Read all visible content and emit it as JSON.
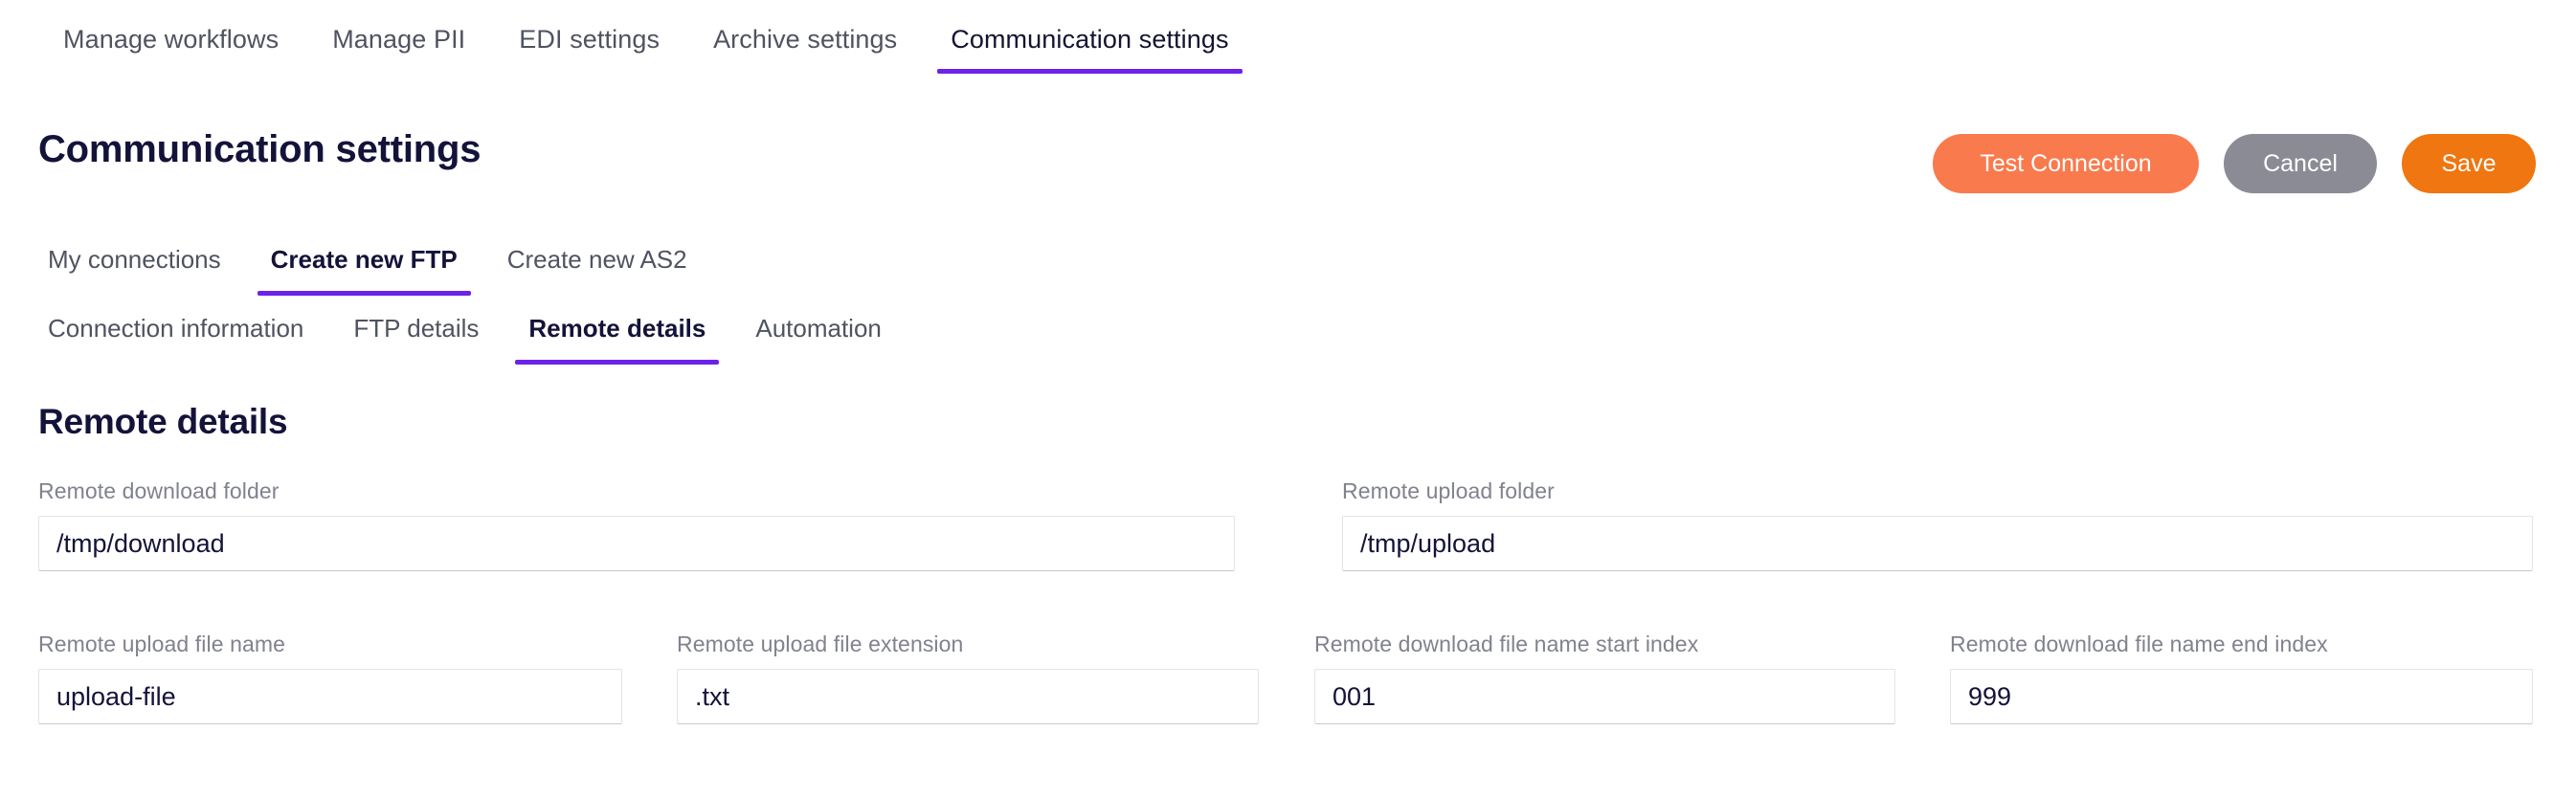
{
  "topnav": {
    "items": [
      {
        "label": "Manage workflows",
        "active": false
      },
      {
        "label": "Manage PII",
        "active": false
      },
      {
        "label": "EDI settings",
        "active": false
      },
      {
        "label": "Archive settings",
        "active": false
      },
      {
        "label": "Communication settings",
        "active": true
      }
    ]
  },
  "header": {
    "title": "Communication settings",
    "actions": {
      "test_connection": "Test Connection",
      "cancel": "Cancel",
      "save": "Save"
    }
  },
  "subnav": {
    "items": [
      {
        "label": "My connections",
        "active": false
      },
      {
        "label": "Create new FTP",
        "active": true
      },
      {
        "label": "Create new AS2",
        "active": false
      }
    ]
  },
  "sectionnav": {
    "items": [
      {
        "label": "Connection information",
        "active": false
      },
      {
        "label": "FTP details",
        "active": false
      },
      {
        "label": "Remote details",
        "active": true
      },
      {
        "label": "Automation",
        "active": false
      }
    ]
  },
  "form": {
    "heading": "Remote details",
    "fields": {
      "remote_download_folder": {
        "label": "Remote download folder",
        "value": "/tmp/download"
      },
      "remote_upload_folder": {
        "label": "Remote upload folder",
        "value": "/tmp/upload"
      },
      "remote_upload_file_name": {
        "label": "Remote upload file name",
        "value": "upload-file"
      },
      "remote_upload_file_extension": {
        "label": "Remote upload file extension",
        "value": ".txt"
      },
      "remote_download_file_name_start_index": {
        "label": "Remote download file name start index",
        "value": "001"
      },
      "remote_download_file_name_end_index": {
        "label": "Remote download file name end index",
        "value": "999"
      }
    }
  },
  "colors": {
    "accent_purple": "#6d22e8",
    "test_connection_orange": "#f97a4d",
    "cancel_gray": "#8b8b96",
    "save_orange": "#ef7610",
    "text_dark": "#13133a",
    "text_muted": "#80828e"
  }
}
